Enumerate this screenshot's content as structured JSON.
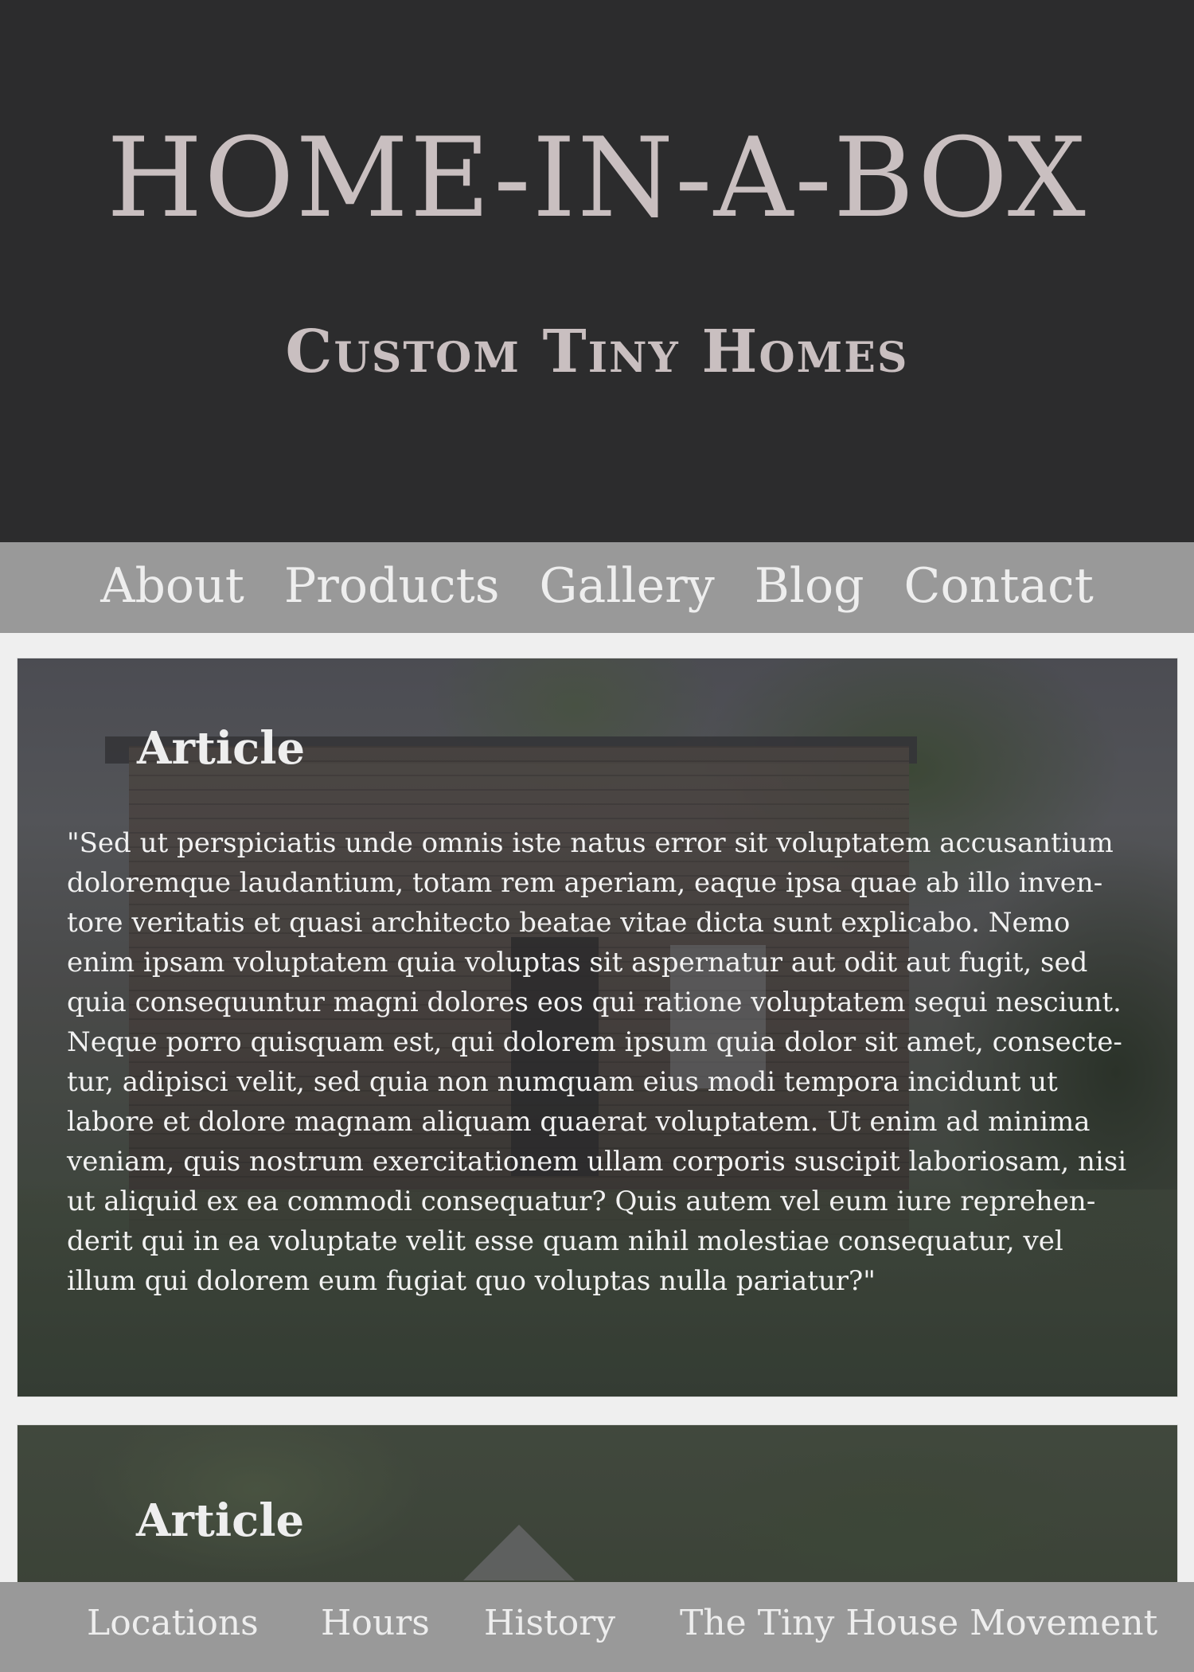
{
  "header": {
    "title": "HOME-IN-A-BOX",
    "subtitle": "Custom Tiny Homes"
  },
  "top_nav": {
    "items": [
      "About",
      "Products",
      "Gallery",
      "Blog",
      "Contact"
    ]
  },
  "articles": [
    {
      "heading": "Article",
      "body": "\"Sed ut perspiciatis unde omnis iste natus error sit voluptatem accusantium\ndoloremque laudantium, totam rem aperiam, eaque ipsa quae ab illo inven-\ntore veritatis et quasi architecto beatae vitae dicta sunt explicabo. Nemo\nenim ipsam voluptatem quia voluptas sit aspernatur aut odit aut fugit, sed\nquia consequuntur magni dolores eos qui ratione voluptatem sequi nesciunt.\nNeque porro quisquam est, qui dolorem ipsum quia dolor sit amet, consecte-\ntur, adipisci velit, sed quia non numquam eius modi tempora incidunt ut\nlabore et dolore magnam aliquam quaerat voluptatem. Ut enim ad minima\nveniam, quis nostrum exercitationem ullam corporis suscipit laboriosam, nisi\nut aliquid ex ea commodi consequatur? Quis autem vel eum iure reprehen-\nderit qui in ea voluptate velit esse quam nihil molestiae consequatur, vel\nillum qui dolorem eum fugiat quo voluptas nulla pariatur?\""
    },
    {
      "heading": "Article"
    }
  ],
  "bottom_nav": {
    "items": [
      "Locations",
      "Hours",
      "History",
      "The Tiny House Movement"
    ]
  },
  "colors": {
    "header_bg": "#2c2c2d",
    "nav_bg": "#999999",
    "title_text": "#c9bfc0",
    "nav_text": "#eeeeee"
  }
}
